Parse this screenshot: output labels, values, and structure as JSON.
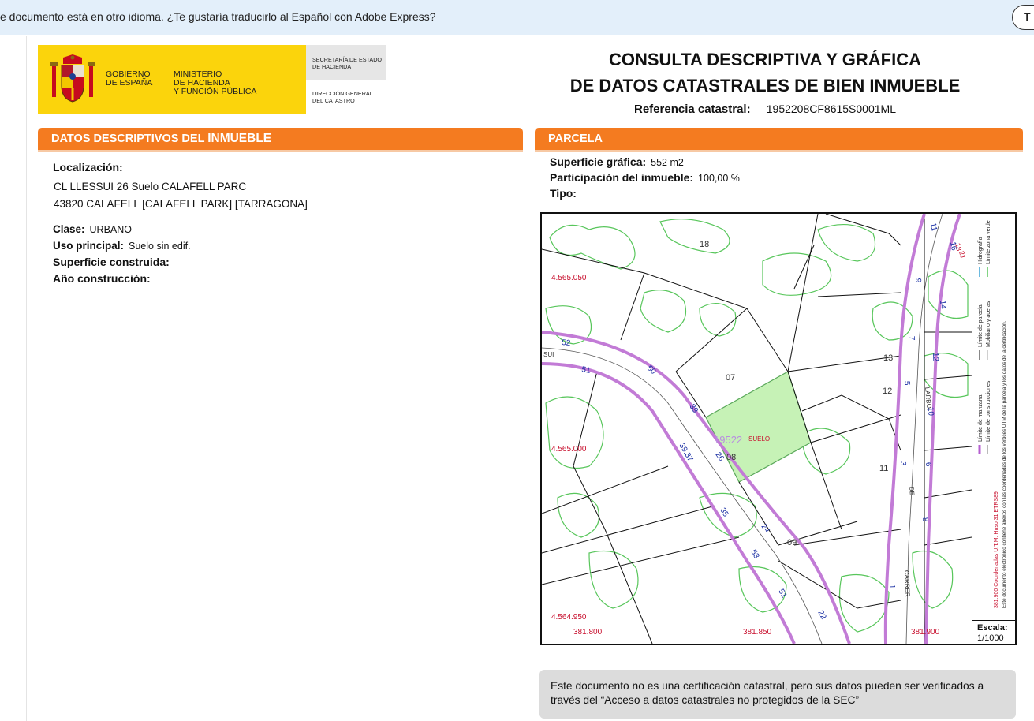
{
  "translate_bar": {
    "message": "e documento está en otro idioma. ¿Te gustaría traducirlo al Español con Adobe Express?",
    "button_label": "T"
  },
  "logo": {
    "gobierno": [
      "GOBIERNO",
      "DE ESPAÑA"
    ],
    "ministerio": [
      "MINISTERIO",
      "DE HACIENDA",
      "Y FUNCIÓN PÚBLICA"
    ],
    "secretaria": [
      "SECRETARÍA DE ESTADO",
      "DE HACIENDA"
    ],
    "direccion": [
      "DIRECCIÓN GENERAL",
      "DEL CATASTRO"
    ]
  },
  "header": {
    "title_line1": "CONSULTA DESCRIPTIVA Y GRÁFICA",
    "title_line2": "DE DATOS CATASTRALES DE BIEN INMUEBLE",
    "ref_label": "Referencia catastral:",
    "ref_value": "1952208CF8615S0001ML"
  },
  "left_section": {
    "title_prefix": "DATOS DESCRIPTIVOS DEL ",
    "title_emph": "INMUEBLE",
    "localizacion_label": "Localización:",
    "address_line1": "CL LLESSUI 26 Suelo CALAFELL PARC",
    "address_line2": "43820 CALAFELL [CALAFELL PARK] [TARRAGONA]",
    "clase_label": "Clase:",
    "clase_value": "URBANO",
    "uso_label": "Uso principal:",
    "uso_value": "Suelo sin edif.",
    "superficie_construida_label": "Superficie construida:",
    "ano_label": "Año construcción:"
  },
  "right_section": {
    "title": "PARCELA",
    "superficie_label": "Superficie gráfica:",
    "superficie_value": "552 m2",
    "participacion_label": "Participación del inmueble:",
    "participacion_value": "100,00 %",
    "tipo_label": "Tipo:"
  },
  "map": {
    "parcel_labels": [
      "18",
      "07",
      "13",
      "12",
      "11",
      "08",
      "09",
      "19522",
      "SUELO"
    ],
    "road_numbers": [
      "52",
      "51",
      "50",
      "39",
      "26",
      "39.37",
      "35",
      "24",
      "53",
      "51",
      "22",
      "11",
      "9",
      "7",
      "5",
      "3",
      "1",
      "16",
      "14",
      "12",
      "10",
      "6",
      "8",
      "18",
      "21"
    ],
    "street_labels": [
      "LARBO.",
      "DE",
      "CARRER",
      "SUI"
    ],
    "utm_y_labels": [
      "4.565.050",
      "4.565.000",
      "4.564.950"
    ],
    "utm_x_labels": [
      "381.800",
      "381.850",
      "381.900"
    ],
    "legend_col1": [
      "Límite de manzana",
      "Límite de parcela",
      "Hidrografía"
    ],
    "legend_col2": [
      "Límite de construcciones",
      "Mobiliario y aceras",
      "Límite zona verde"
    ],
    "legend_coord_note": "381.900 Coordenadas U.T.M. Huso 31 ETRS89",
    "legend_doc_note": "Este documento electrónico contiene anexos con las coordenadas de los vértices UTM de la parcela y los datos de la certificación.",
    "scale_label": "Escala:",
    "scale_value": "1/1000"
  },
  "note": {
    "line1": "Este documento no es una certificación catastral, pero sus datos pueden ser verificados a",
    "line2": "través del “Acceso a datos catastrales no protegidos de la SEC”"
  },
  "colors": {
    "orange": "#f47b20",
    "yellow": "#fbd40c",
    "parcel_fill": "#c6f2b6",
    "green_zone": "#58c65b",
    "road_purple": "#c27bd6",
    "road_label": "#1a2fa3",
    "utm_red": "#c8102e"
  }
}
